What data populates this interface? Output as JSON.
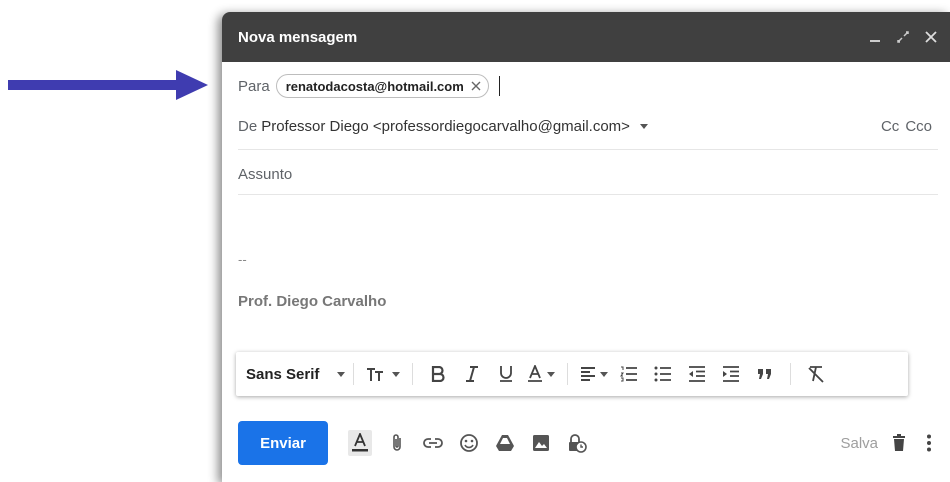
{
  "annotation": {
    "arrow_color": "#3f3cb0"
  },
  "window": {
    "title": "Nova mensagem",
    "controls": {
      "minimize_icon": "minimize-icon",
      "expand_icon": "expand-icon",
      "close_icon": "close-icon"
    }
  },
  "to": {
    "label": "Para",
    "recipient_chip": "renatodacosta@hotmail.com",
    "remove_icon": "close-icon"
  },
  "from": {
    "label": "De",
    "sender": "Professor Diego <professordiegocarvalho@gmail.com>",
    "cc_label": "Cc",
    "bcc_label": "Cco"
  },
  "subject": {
    "placeholder": "Assunto",
    "value": ""
  },
  "signature": {
    "separator": "--",
    "name": "Prof. Diego Carvalho"
  },
  "formatting_toolbar": {
    "font": "Sans Serif",
    "tools": [
      "text-size-icon",
      "bold-icon",
      "italic-icon",
      "underline-icon",
      "text-color-icon",
      "align-icon",
      "numbered-list-icon",
      "bulleted-list-icon",
      "indent-less-icon",
      "indent-more-icon",
      "quote-icon",
      "remove-formatting-icon"
    ]
  },
  "bottom_toolbar": {
    "send_label": "Enviar",
    "saved_label": "Salva",
    "colors": {
      "send_button": "#1a73e8"
    }
  }
}
